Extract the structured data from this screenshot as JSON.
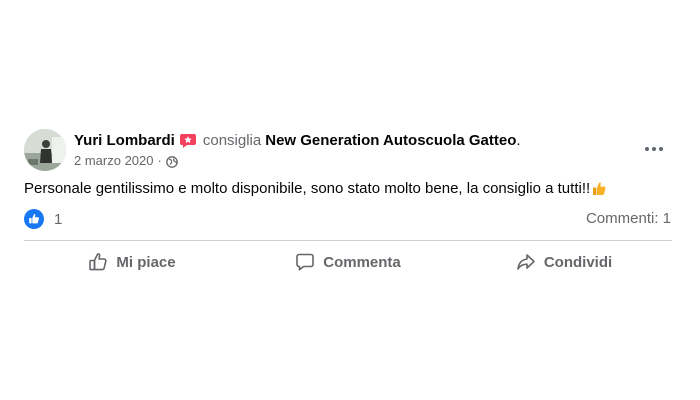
{
  "post": {
    "author": "Yuri Lombardi",
    "action": "consiglia",
    "page": "New Generation Autoscuola Gatteo",
    "punct": ".",
    "date": "2 marzo 2020",
    "separator": "·",
    "privacy_icon": "globe-icon",
    "text": "Personale gentilissimo e molto disponibile, sono stato molto bene, la consiglio a tutti!!",
    "emoji": "👍"
  },
  "stats": {
    "reaction_icon": "like-icon",
    "reaction_count": "1",
    "comments": "Commenti: 1"
  },
  "actions": {
    "like_label": "Mi piace",
    "comment_label": "Commenta",
    "share_label": "Condividi"
  },
  "colors": {
    "accent": "#1877f2",
    "badge": "#f3425f",
    "secondary_text": "#65676b"
  }
}
